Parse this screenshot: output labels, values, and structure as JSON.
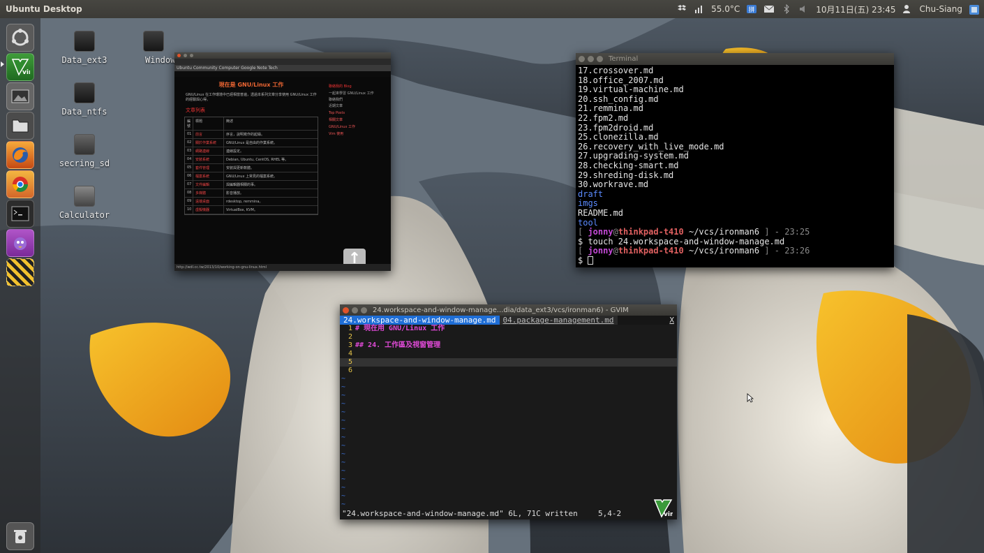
{
  "panel": {
    "app_title": "Ubuntu Desktop",
    "temperature": "55.0°C",
    "datetime": "10月11日(五) 23:45",
    "user": "Chu-Siang"
  },
  "desktop_icons": [
    {
      "label": "Data_ext3"
    },
    {
      "label": "Window"
    },
    {
      "label": "Data_ntfs"
    },
    {
      "label": "secring_sd"
    },
    {
      "label": "Calculator"
    }
  ],
  "browser": {
    "bookmarks": "Ubuntu  Community  Computer  Google  Note  Tech",
    "page_title": "現在是 GNU/Linux 工作",
    "intro": "GNU/Linux 在工作環境中已經相當普遍，透過本系列文章分享使用 GNU/Linux 工作的經驗與心得。",
    "section": "文章列表",
    "table_header": [
      "編號",
      "標題",
      "簡述"
    ],
    "rows": [
      {
        "n": "01",
        "t": "前言",
        "d": "序言，說明寫作的起緣。"
      },
      {
        "n": "02",
        "t": "關於作業系統",
        "d": "GNU/Linux 是自由的作業系統。"
      },
      {
        "n": "03",
        "t": "網路連線",
        "d": "連線設定。"
      },
      {
        "n": "04",
        "t": "安裝系統",
        "d": "Debian, Ubuntu, CentOS, RHEL 等。"
      },
      {
        "n": "05",
        "t": "套件管理",
        "d": "安裝與更新軟體。"
      },
      {
        "n": "06",
        "t": "檔案系統",
        "d": "GNU/Linux 上常見的檔案系統。"
      },
      {
        "n": "07",
        "t": "文件編輯",
        "d": "與編輯器相關的事。"
      },
      {
        "n": "08",
        "t": "多媒體",
        "d": "影音播放。"
      },
      {
        "n": "09",
        "t": "遠端桌面",
        "d": "rdesktop, remmina。"
      },
      {
        "n": "10",
        "t": "虛擬機器",
        "d": "VirtualBox, KVM。"
      }
    ],
    "side_head": "聯絡我的 Blog",
    "side_texts": [
      "一起來學習 GNU/Linux 工作",
      "聯絡我們",
      "近期文章"
    ],
    "side_links": [
      "Top Posts",
      "相關文章",
      "GNU/Linux 工作",
      "Vim 使用"
    ],
    "status": "http://wdl.cc.tw/2013/10/working-on-gnu-linux.html"
  },
  "terminal": {
    "title": "Terminal",
    "files": [
      "17.crossover.md",
      "18.office_2007.md",
      "19.virtual-machine.md",
      "20.ssh_config.md",
      "21.remmina.md",
      "22.fpm2.md",
      "23.fpm2droid.md",
      "25.clonezilla.md",
      "26.recovery_with_live_mode.md",
      "27.upgrading-system.md",
      "28.checking-smart.md",
      "29.shreding-disk.md",
      "30.workrave.md"
    ],
    "dirs": [
      "draft",
      "imgs"
    ],
    "readme": "README.md",
    "tool": "tool",
    "prompt_user": "jonny",
    "prompt_host": "thinkpad-t410",
    "prompt_path": "~/vcs/ironman6",
    "prompt_time1": "23:25",
    "command": "touch 24.workspace-and-window-manage.md",
    "prompt_time2": "23:26"
  },
  "gvim": {
    "title": "24.workspace-and-window-manage...dia/data_ext3/vcs/ironman6) - GVIM",
    "tab_active": "24.workspace-and-window-manage.md",
    "tab_inactive": "04.package-management.md",
    "tab_close": "X",
    "lines": [
      {
        "n": "1",
        "text": "# 現在用 GNU/Linux 工作"
      },
      {
        "n": "2",
        "text": ""
      },
      {
        "n": "3",
        "text": "## 24. 工作區及視窗管理"
      },
      {
        "n": "4",
        "text": ""
      },
      {
        "n": "5",
        "text": ""
      },
      {
        "n": "6",
        "text": ""
      }
    ],
    "status_msg": "\"24.workspace-and-window-manage.md\" 6L, 71C written",
    "status_pos": "5,4-2"
  },
  "colors": {
    "panel_bg": "#3c3b37",
    "vim_tab_active": "#1f6ed6",
    "vim_heading": "#e04ad7",
    "term_prompt_user": "#c54ad8",
    "term_dir": "#5b8bff"
  }
}
